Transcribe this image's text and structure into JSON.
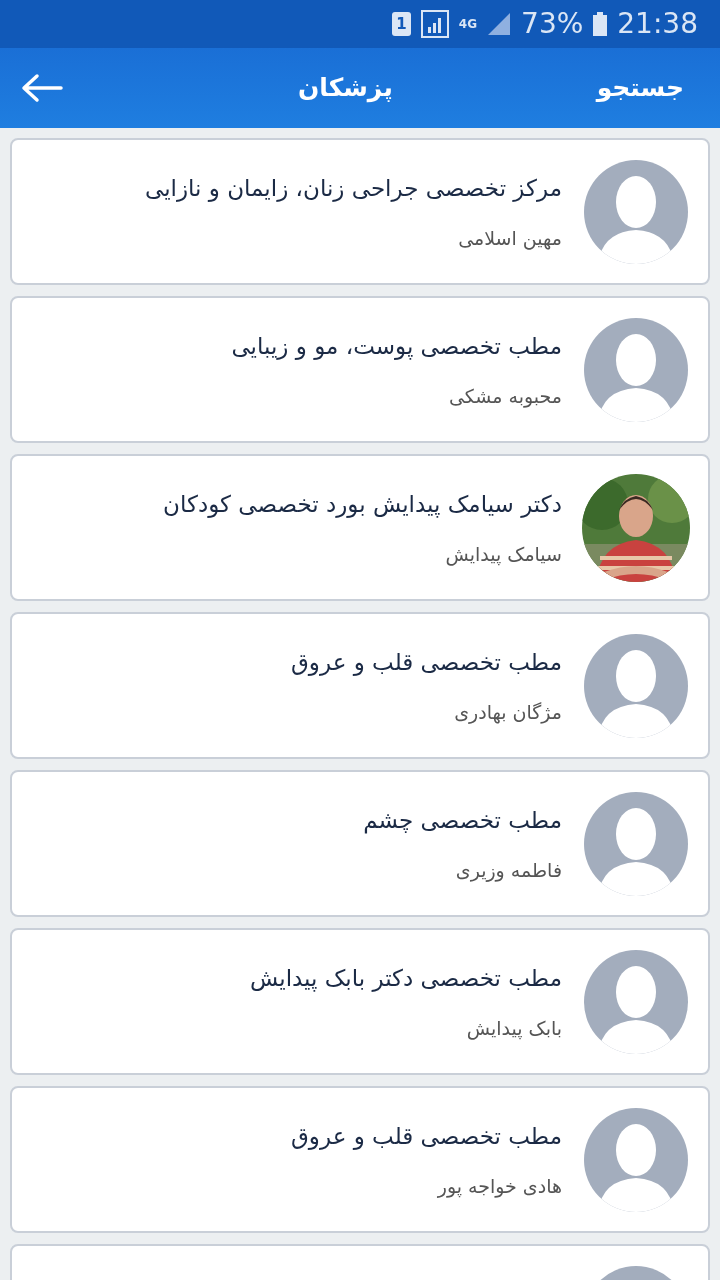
{
  "status_bar": {
    "sim": "1",
    "network": "4G",
    "battery": "73%",
    "time": "21:38"
  },
  "header": {
    "search": "جستجو",
    "title": "پزشکان"
  },
  "doctors": [
    {
      "title": "مرکز تخصصی جراحی زنان، زایمان و نازایی",
      "name": "مهین اسلامی",
      "kind": "placeholder"
    },
    {
      "title": "مطب تخصصی پوست، مو و زیبایی",
      "name": "محبوبه مشکی",
      "kind": "placeholder"
    },
    {
      "title": "دکتر سیامک پیدایش بورد تخصصی کودکان",
      "name": "سیامک پیدایش"
    },
    {
      "title": "مطب تخصصی قلب و عروق",
      "name": "مژگان بهادری",
      "kind": "placeholder"
    },
    {
      "title": "مطب تخصصی چشم",
      "name": "فاطمه وزیری",
      "kind": "placeholder"
    },
    {
      "title": "مطب تخصصی دکتر بابک پیدایش",
      "name": "بابک پیدایش",
      "kind": "placeholder"
    },
    {
      "title": "مطب تخصصی قلب و عروق",
      "name": "هادی خواجه پور",
      "kind": "placeholder"
    },
    {
      "kind": "placeholder"
    }
  ]
}
